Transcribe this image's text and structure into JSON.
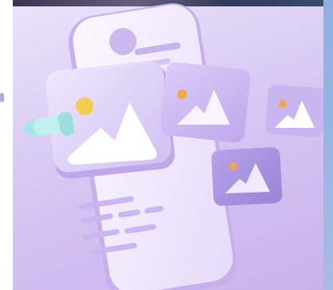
{
  "scene": {
    "description_colors": {
      "background": "#d9c9f3",
      "phone_body": "#f6f1ff",
      "phone_edge": "#c4adea",
      "card_light": "#ece2fb",
      "card_mid": "#cbb6ef",
      "card_dark": "#9d86d8",
      "sun": "#f2cf4a",
      "pin": "#a8e6e6"
    },
    "icons": [
      "phone-icon",
      "image-placeholder-icon",
      "pointer-hand-icon"
    ]
  }
}
